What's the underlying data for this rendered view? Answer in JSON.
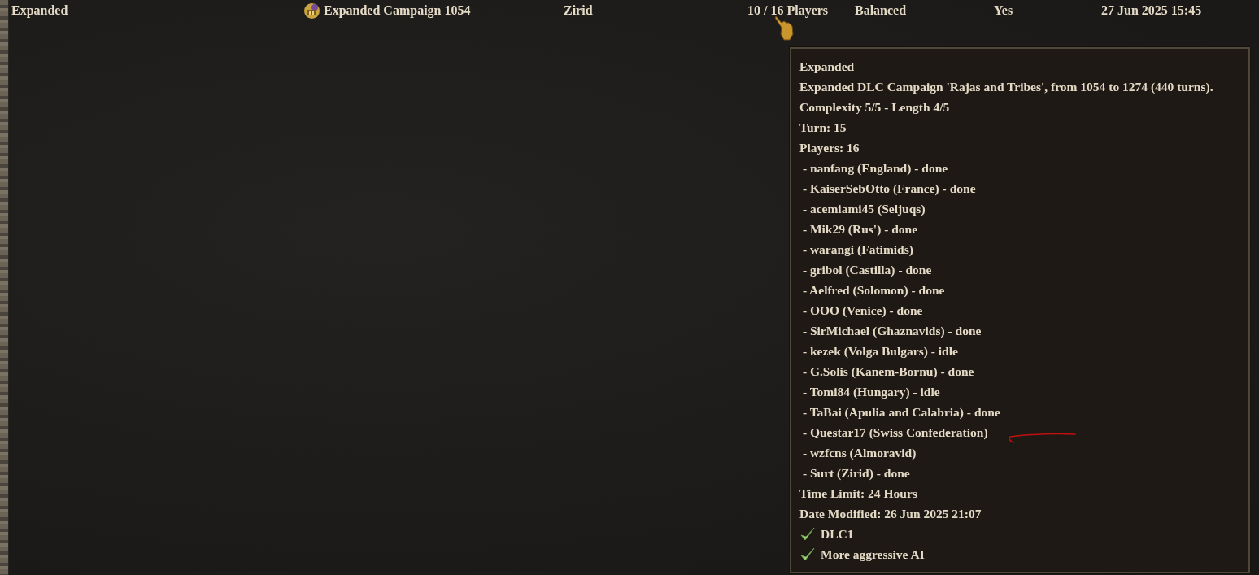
{
  "row": {
    "cells": [
      {
        "text": "Expanded"
      },
      {
        "text": "Expanded Campaign 1054",
        "icon": true
      },
      {
        "text": "Zirid"
      },
      {
        "text": "10 / 16 Players"
      },
      {
        "text": "Balanced"
      },
      {
        "text": "Yes"
      },
      {
        "text": "27 Jun 2025 15:45"
      }
    ]
  },
  "tooltip": {
    "title": "Expanded",
    "description": "Expanded DLC Campaign 'Rajas and Tribes', from 1054 to 1274 (440 turns).",
    "complexity": "Complexity 5/5 - Length 4/5",
    "turn": "Turn: 15",
    "players_label": "Players: 16",
    "players": [
      {
        "text": " - nanfang (England) - done"
      },
      {
        "text": " - KaiserSebOtto (France) - done"
      },
      {
        "text": " - acemiami45 (Seljuqs)"
      },
      {
        "text": " - Mik29 (Rus') - done"
      },
      {
        "text": " - warangi (Fatimids)"
      },
      {
        "text": " - gribol (Castilla) - done"
      },
      {
        "text": " - Aelfred (Solomon) - done"
      },
      {
        "text": " - OOO (Venice) - done"
      },
      {
        "text": " - SirMichael (Ghaznavids) - done"
      },
      {
        "text": " - kezek (Volga Bulgars) - idle"
      },
      {
        "text": " - G.Solis (Kanem-Bornu) - done"
      },
      {
        "text": " - Tomi84 (Hungary) - idle"
      },
      {
        "text": " - TaBai (Apulia and Calabria) - done"
      },
      {
        "text": " - Questar17 (Swiss Confederation)",
        "annotated": true
      },
      {
        "text": " - wzfcns (Almoravid)"
      },
      {
        "text": " - Surt (Zirid) - done"
      }
    ],
    "time_limit": "Time Limit: 24 Hours",
    "date_modified": "Date Modified: 26 Jun 2025 21:07",
    "options": [
      {
        "label": "DLC1",
        "checked": true
      },
      {
        "label": "More aggressive AI",
        "checked": true
      }
    ]
  }
}
